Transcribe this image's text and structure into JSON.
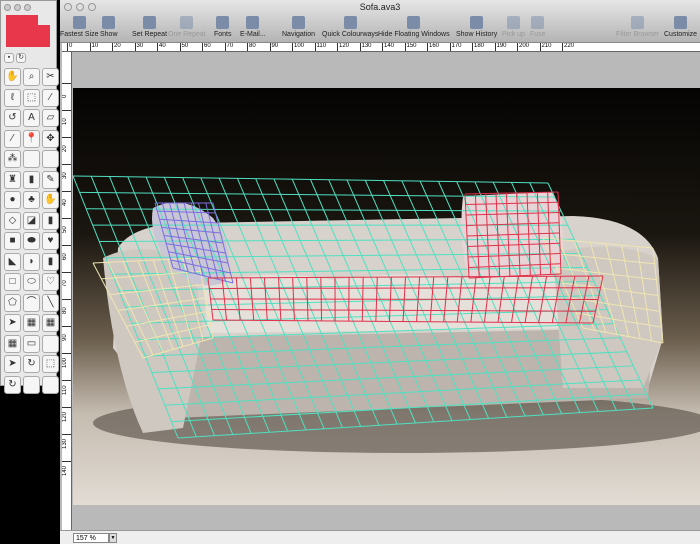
{
  "window": {
    "title": "Sofa.ava3"
  },
  "toolbar": {
    "items": [
      {
        "label": "Fastest Size",
        "icon": "magnifier-icon",
        "enabled": true
      },
      {
        "label": "Show",
        "icon": "show-icon",
        "enabled": true
      },
      {
        "label": "Set Repeat",
        "icon": "set-repeat-icon",
        "enabled": true
      },
      {
        "label": "One Repeat",
        "icon": "one-repeat-icon",
        "enabled": false
      },
      {
        "label": "Fonts",
        "icon": "fonts-icon",
        "enabled": true
      },
      {
        "label": "E-Mail...",
        "icon": "email-icon",
        "enabled": true
      },
      {
        "label": "Navigation",
        "icon": "navigation-icon",
        "enabled": true
      },
      {
        "label": "Quick Colourways",
        "icon": "colourways-icon",
        "enabled": true
      },
      {
        "label": "Hide Floating Windows",
        "icon": "hide-windows-icon",
        "enabled": true
      },
      {
        "label": "Show History",
        "icon": "history-icon",
        "enabled": true
      },
      {
        "label": "Pick up",
        "icon": "pick-up-icon",
        "enabled": false
      },
      {
        "label": "Fuse",
        "icon": "fuse-icon",
        "enabled": false
      },
      {
        "label": "Filter Browser",
        "icon": "filter-browser-icon",
        "enabled": false
      },
      {
        "label": "Customize",
        "icon": "customize-icon",
        "enabled": true
      }
    ]
  },
  "ruler_top": [
    "0",
    "10",
    "20",
    "30",
    "40",
    "50",
    "60",
    "70",
    "80",
    "90",
    "100",
    "110",
    "120",
    "130",
    "140",
    "150",
    "160",
    "170",
    "180",
    "190",
    "200",
    "210",
    "220"
  ],
  "ruler_left": [
    "0",
    "10",
    "20",
    "30",
    "40",
    "50",
    "60",
    "70",
    "80",
    "90",
    "100",
    "110",
    "120",
    "130",
    "140"
  ],
  "palette": {
    "swatch_color": "#e8364a",
    "tools": [
      "hand",
      "zoom",
      "scissors",
      "lasso",
      "marquee",
      "eyedropper",
      "rotate",
      "text",
      "distort",
      "brush",
      "pin",
      "move",
      "scatter",
      "",
      "",
      "stamp",
      "spray",
      "pencil",
      "dropper",
      "blend",
      "smudge",
      "eraser",
      "fill",
      "fill-pattern",
      "rect-fill",
      "ellipse-fill",
      "heart-fill",
      "shape-fill",
      "quarter-fill",
      "gradient",
      "rect",
      "ellipse",
      "heart",
      "poly",
      "curve",
      "line",
      "select",
      "mesh",
      "mesh-grid",
      "grid",
      "ruler",
      "",
      "direct-select",
      "rotate-view",
      "crop",
      "path-rotate",
      "",
      ""
    ]
  },
  "status": {
    "zoom": "157 %"
  },
  "colors": {
    "mesh_body": "#4fe0c0",
    "mesh_pillow_left": "#7b6ee0",
    "mesh_red": "#e0304a",
    "mesh_arm": "#f0e6b0"
  }
}
